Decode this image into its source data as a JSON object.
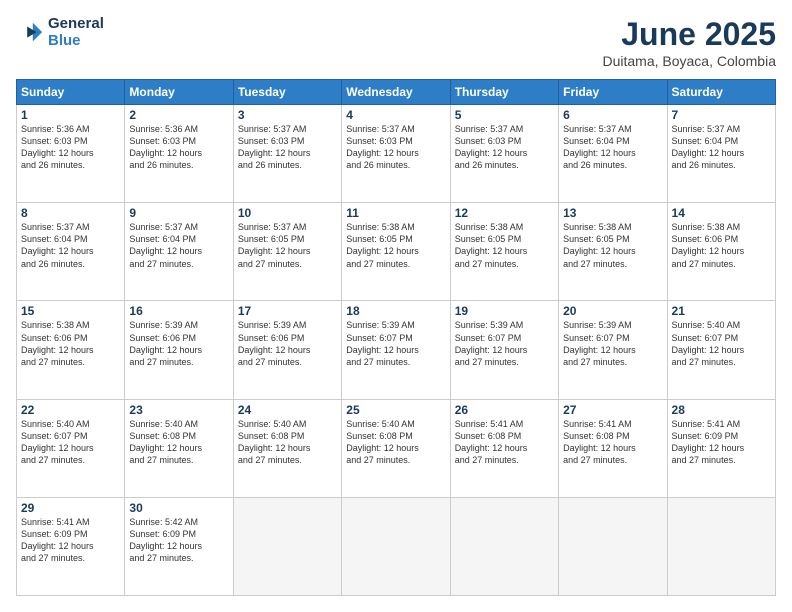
{
  "header": {
    "logo_line1": "General",
    "logo_line2": "Blue",
    "month": "June 2025",
    "location": "Duitama, Boyaca, Colombia"
  },
  "days_of_week": [
    "Sunday",
    "Monday",
    "Tuesday",
    "Wednesday",
    "Thursday",
    "Friday",
    "Saturday"
  ],
  "weeks": [
    [
      {
        "day": "1",
        "text": "Sunrise: 5:36 AM\nSunset: 6:03 PM\nDaylight: 12 hours\nand 26 minutes."
      },
      {
        "day": "2",
        "text": "Sunrise: 5:36 AM\nSunset: 6:03 PM\nDaylight: 12 hours\nand 26 minutes."
      },
      {
        "day": "3",
        "text": "Sunrise: 5:37 AM\nSunset: 6:03 PM\nDaylight: 12 hours\nand 26 minutes."
      },
      {
        "day": "4",
        "text": "Sunrise: 5:37 AM\nSunset: 6:03 PM\nDaylight: 12 hours\nand 26 minutes."
      },
      {
        "day": "5",
        "text": "Sunrise: 5:37 AM\nSunset: 6:03 PM\nDaylight: 12 hours\nand 26 minutes."
      },
      {
        "day": "6",
        "text": "Sunrise: 5:37 AM\nSunset: 6:04 PM\nDaylight: 12 hours\nand 26 minutes."
      },
      {
        "day": "7",
        "text": "Sunrise: 5:37 AM\nSunset: 6:04 PM\nDaylight: 12 hours\nand 26 minutes."
      }
    ],
    [
      {
        "day": "8",
        "text": "Sunrise: 5:37 AM\nSunset: 6:04 PM\nDaylight: 12 hours\nand 26 minutes."
      },
      {
        "day": "9",
        "text": "Sunrise: 5:37 AM\nSunset: 6:04 PM\nDaylight: 12 hours\nand 27 minutes."
      },
      {
        "day": "10",
        "text": "Sunrise: 5:37 AM\nSunset: 6:05 PM\nDaylight: 12 hours\nand 27 minutes."
      },
      {
        "day": "11",
        "text": "Sunrise: 5:38 AM\nSunset: 6:05 PM\nDaylight: 12 hours\nand 27 minutes."
      },
      {
        "day": "12",
        "text": "Sunrise: 5:38 AM\nSunset: 6:05 PM\nDaylight: 12 hours\nand 27 minutes."
      },
      {
        "day": "13",
        "text": "Sunrise: 5:38 AM\nSunset: 6:05 PM\nDaylight: 12 hours\nand 27 minutes."
      },
      {
        "day": "14",
        "text": "Sunrise: 5:38 AM\nSunset: 6:06 PM\nDaylight: 12 hours\nand 27 minutes."
      }
    ],
    [
      {
        "day": "15",
        "text": "Sunrise: 5:38 AM\nSunset: 6:06 PM\nDaylight: 12 hours\nand 27 minutes."
      },
      {
        "day": "16",
        "text": "Sunrise: 5:39 AM\nSunset: 6:06 PM\nDaylight: 12 hours\nand 27 minutes."
      },
      {
        "day": "17",
        "text": "Sunrise: 5:39 AM\nSunset: 6:06 PM\nDaylight: 12 hours\nand 27 minutes."
      },
      {
        "day": "18",
        "text": "Sunrise: 5:39 AM\nSunset: 6:07 PM\nDaylight: 12 hours\nand 27 minutes."
      },
      {
        "day": "19",
        "text": "Sunrise: 5:39 AM\nSunset: 6:07 PM\nDaylight: 12 hours\nand 27 minutes."
      },
      {
        "day": "20",
        "text": "Sunrise: 5:39 AM\nSunset: 6:07 PM\nDaylight: 12 hours\nand 27 minutes."
      },
      {
        "day": "21",
        "text": "Sunrise: 5:40 AM\nSunset: 6:07 PM\nDaylight: 12 hours\nand 27 minutes."
      }
    ],
    [
      {
        "day": "22",
        "text": "Sunrise: 5:40 AM\nSunset: 6:07 PM\nDaylight: 12 hours\nand 27 minutes."
      },
      {
        "day": "23",
        "text": "Sunrise: 5:40 AM\nSunset: 6:08 PM\nDaylight: 12 hours\nand 27 minutes."
      },
      {
        "day": "24",
        "text": "Sunrise: 5:40 AM\nSunset: 6:08 PM\nDaylight: 12 hours\nand 27 minutes."
      },
      {
        "day": "25",
        "text": "Sunrise: 5:40 AM\nSunset: 6:08 PM\nDaylight: 12 hours\nand 27 minutes."
      },
      {
        "day": "26",
        "text": "Sunrise: 5:41 AM\nSunset: 6:08 PM\nDaylight: 12 hours\nand 27 minutes."
      },
      {
        "day": "27",
        "text": "Sunrise: 5:41 AM\nSunset: 6:08 PM\nDaylight: 12 hours\nand 27 minutes."
      },
      {
        "day": "28",
        "text": "Sunrise: 5:41 AM\nSunset: 6:09 PM\nDaylight: 12 hours\nand 27 minutes."
      }
    ],
    [
      {
        "day": "29",
        "text": "Sunrise: 5:41 AM\nSunset: 6:09 PM\nDaylight: 12 hours\nand 27 minutes."
      },
      {
        "day": "30",
        "text": "Sunrise: 5:42 AM\nSunset: 6:09 PM\nDaylight: 12 hours\nand 27 minutes."
      },
      {
        "day": "",
        "text": ""
      },
      {
        "day": "",
        "text": ""
      },
      {
        "day": "",
        "text": ""
      },
      {
        "day": "",
        "text": ""
      },
      {
        "day": "",
        "text": ""
      }
    ]
  ]
}
